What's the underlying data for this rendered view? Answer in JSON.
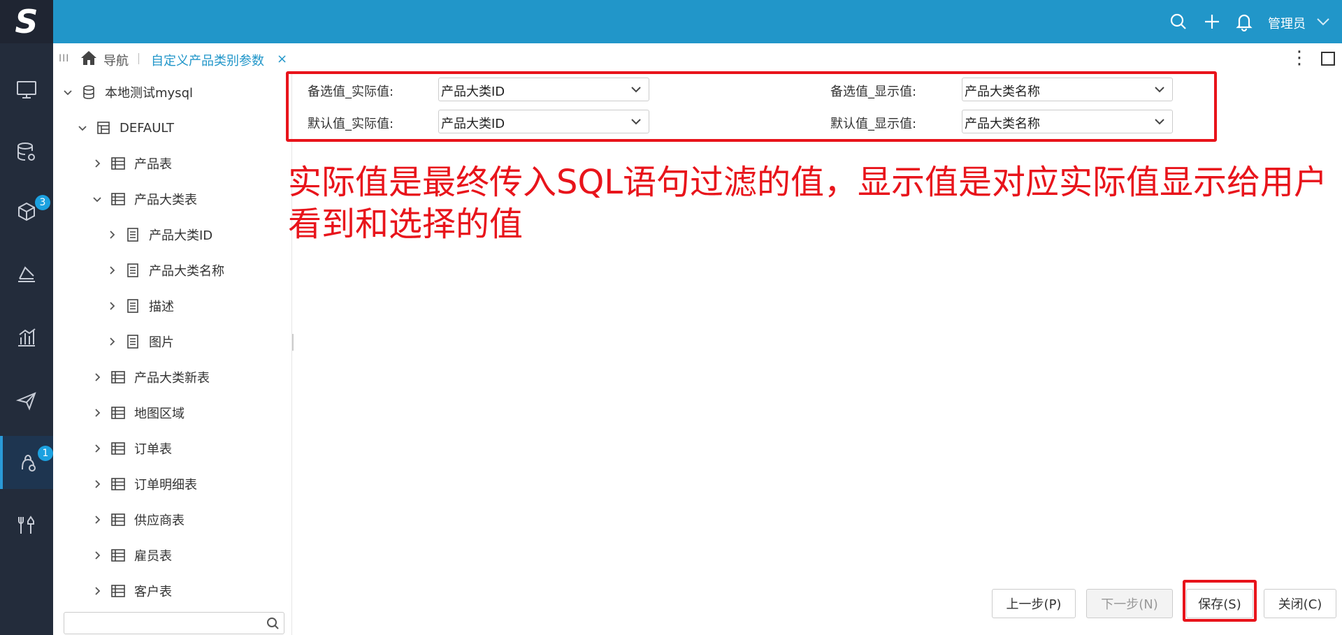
{
  "topbar": {
    "user_name": "管理员"
  },
  "rail": {
    "badges": {
      "item3": "3",
      "item7": "1"
    }
  },
  "tabbar": {
    "grip": "III",
    "nav_label": "导航",
    "active_tab": "自定义产品类别参数",
    "close": "×",
    "more": "⋮"
  },
  "tree": {
    "root": "本地测试mysql",
    "schema": "DEFAULT",
    "items": [
      "产品表",
      "产品大类表",
      "产品大类ID",
      "产品大类名称",
      "描述",
      "图片",
      "产品大类新表",
      "地图区域",
      "订单表",
      "订单明细表",
      "供应商表",
      "雇员表",
      "客户表"
    ],
    "search_placeholder": ""
  },
  "params": {
    "opt_actual_label": "备选值_实际值:",
    "opt_actual_value": "产品大类ID",
    "opt_display_label": "备选值_显示值:",
    "opt_display_value": "产品大类名称",
    "def_actual_label": "默认值_实际值:",
    "def_actual_value": "产品大类ID",
    "def_display_label": "默认值_显示值:",
    "def_display_value": "产品大类名称"
  },
  "annotation": {
    "line1": "实际值是最终传入SQL语句过滤的值，显示值是对应实际值显示给用户",
    "line2": "看到和选择的值"
  },
  "footer": {
    "prev": "上一步(P)",
    "next": "下一步(N)",
    "save": "保存(S)",
    "close": "关闭(C)"
  },
  "colors": {
    "topbar": "#2196c9",
    "rail": "#232c3b",
    "highlight": "#e8141b"
  }
}
